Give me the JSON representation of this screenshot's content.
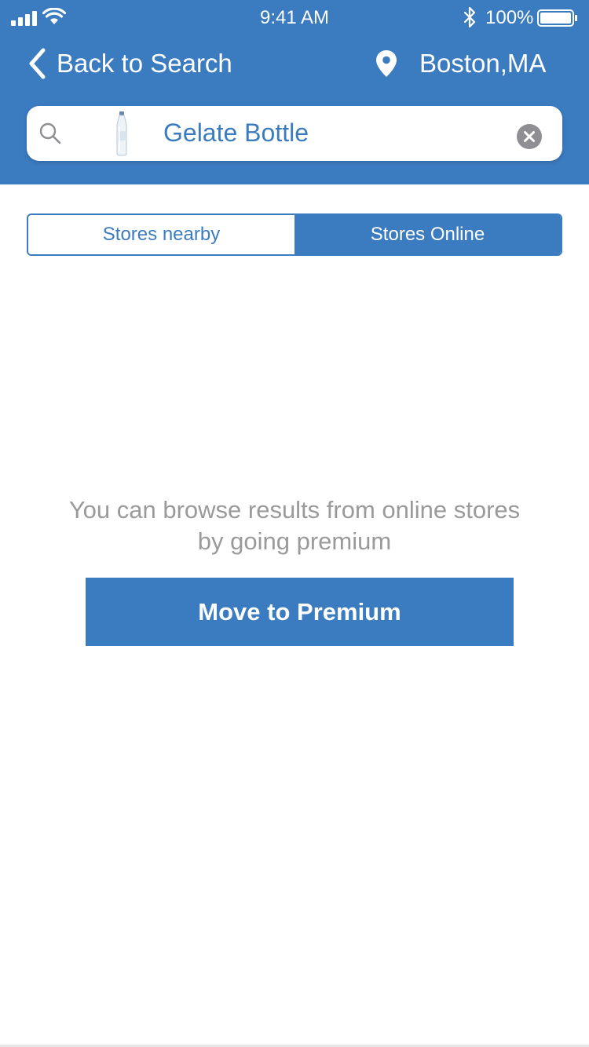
{
  "status_bar": {
    "time": "9:41 AM",
    "battery_percent": "100%",
    "icons": [
      "signal-icon",
      "wifi-icon",
      "bluetooth-icon",
      "battery-icon"
    ]
  },
  "nav": {
    "back_label": "Back to Search",
    "location_label": "Boston,MA"
  },
  "search": {
    "value": "Gelate Bottle",
    "icons": [
      "search-icon",
      "bottle-thumbnail",
      "clear-icon"
    ]
  },
  "segmented": {
    "options": [
      "Stores nearby",
      "Stores Online"
    ],
    "selected": "Stores Online"
  },
  "main": {
    "message_line1": "You can browse results from online stores",
    "message_line2": "by going premium",
    "cta_label": "Move to Premium"
  },
  "colors": {
    "primary": "#3b7bc0",
    "message_text": "#9a9a9a",
    "background": "#ffffff"
  }
}
